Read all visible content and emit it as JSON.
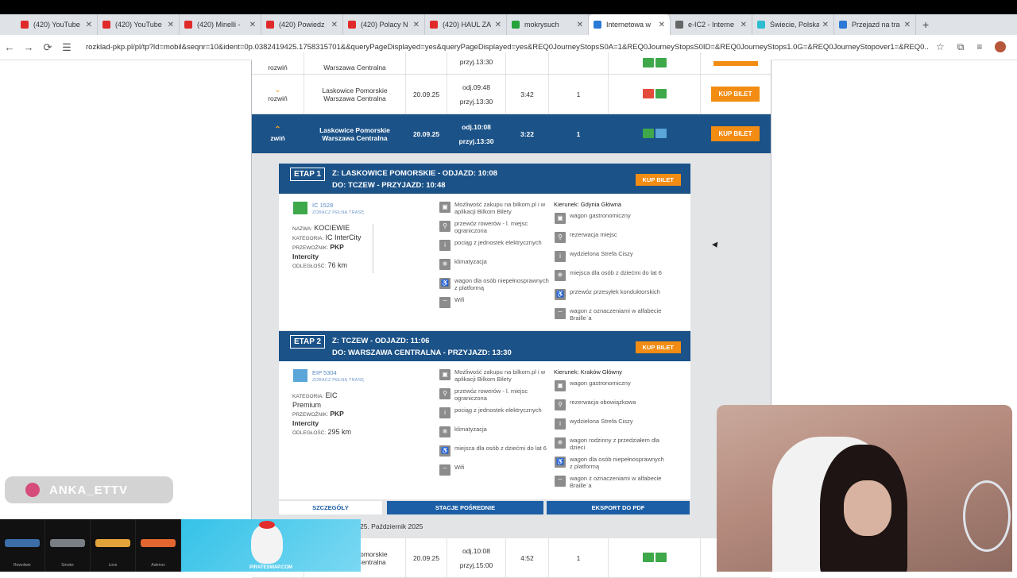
{
  "browser": {
    "tabs": [
      {
        "title": "(420) YouTube",
        "color": "#e02a2a"
      },
      {
        "title": "(420) YouTube",
        "color": "#e02a2a"
      },
      {
        "title": "(420) Minelli -",
        "color": "#e02a2a"
      },
      {
        "title": "(420) Powiedz",
        "color": "#e02a2a"
      },
      {
        "title": "(420) Polacy N",
        "color": "#e02a2a"
      },
      {
        "title": "(420) HAUL ZA",
        "color": "#e02a2a"
      },
      {
        "title": "mokrysuch",
        "color": "#25a33a"
      },
      {
        "title": "Internetowa w",
        "color": "#2b79d6"
      },
      {
        "title": "e-IC2 - Interne",
        "color": "#666666"
      },
      {
        "title": "Świecie, Polska",
        "color": "#2dbcd0"
      },
      {
        "title": "Przejazd na tra",
        "color": "#2b79d6"
      }
    ],
    "url": "rozklad-pkp.pl/pl/tp?ld=mobil&seqnr=10&ident=0p.0382419425.1758315701&&queryPageDisplayed=yes&queryPageDisplayed=yes&REQ0JourneyStopsS0A=1&REQ0JourneyStopsS0ID=&REQ0JourneyStops1.0G=&REQ0JourneyStopover1=&REQ0..."
  },
  "rows": {
    "top": {
      "toggle": "rozwiń",
      "from": "Laskowice Pomorskie",
      "to": "Warszawa Centralna",
      "arr": "przyj.13:30"
    },
    "r1": {
      "toggle": "rozwiń",
      "from": "Laskowice Pomorskie",
      "to": "Warszawa Centralna",
      "date": "20.09.25",
      "dep": "odj.09:48",
      "arr": "przyj.13:30",
      "dur": "3:42",
      "changes": "1",
      "buy": "KUP BILET"
    },
    "r2": {
      "toggle": "zwiń",
      "from": "Laskowice Pomorskie",
      "to": "Warszawa Centralna",
      "date": "20.09.25",
      "dep": "odj.10:08",
      "arr": "przyj.13:30",
      "dur": "3:22",
      "changes": "1",
      "buy": "KUP BILET"
    },
    "r3": {
      "from": "Laskowice Pomorskie",
      "to": "Warszawa Centralna",
      "date": "20.09.25",
      "dep": "odj.10:08",
      "arr": "przyj.15:00",
      "dur": "4:52",
      "changes": "1"
    }
  },
  "etap1": {
    "badge": "ETAP 1",
    "line1": "Z: LASKOWICE POMORSKIE - ODJAZD: 10:08",
    "line2": "DO: TCZEW - PRZYJAZD: 10:48",
    "buy": "KUP BILET",
    "train_no": "IC 1528",
    "route_link": "ZOBACZ PEŁNĄ TRASĘ",
    "nazwa_k": "NAZWA:",
    "nazwa_v": "KOCIEWIE",
    "kat_k": "KATEGORIA:",
    "kat_v": "IC InterCity",
    "prz_k": "PRZEWOŹNIK:",
    "prz_v": "PKP Intercity",
    "odl_k": "ODLEGŁOŚĆ:",
    "odl_v": "76 km",
    "kierunek": "Kierunek: Gdynia Główna",
    "features_left": [
      "Możliwość zakupu na bilkom.pl i w aplikacji Bilkom Bilety",
      "przewóz rowerów - l. miejsc ograniczona",
      "pociąg z jednostek elektrycznych",
      "klimatyzacja",
      "wagon dla osób niepełnosprawnych z platformą",
      "Wifi"
    ],
    "features_right": [
      "wagon gastronomiczny",
      "rezerwacja miejsc",
      "wydzielona Strefa Ciszy",
      "miejsca dla osób z dziećmi do lat 6",
      "przewóz przesyłek konduktorskich",
      "wagon z oznaczeniami w alfabecie Braille`a"
    ]
  },
  "etap2": {
    "badge": "ETAP 2",
    "line1": "Z: TCZEW - ODJAZD: 11:06",
    "line2": "DO: WARSZAWA CENTRALNA - PRZYJAZD: 13:30",
    "buy": "KUP BILET",
    "train_no": "EIP 5304",
    "route_link": "ZOBACZ PEŁNĄ TRASĘ",
    "kat_k": "KATEGORIA:",
    "kat_v": "EIC Premium",
    "prz_k": "PRZEWOŹNIK:",
    "prz_v": "PKP Intercity",
    "odl_k": "ODLEGŁOŚĆ:",
    "odl_v": "295 km",
    "kierunek": "Kierunek: Kraków Główny",
    "features_left": [
      "Możliwość zakupu na bilkom.pl i w aplikacji Bilkom Bilety",
      "przewóz rowerów - l. miejsc ograniczona",
      "pociąg z jednostek elektrycznych",
      "klimatyzacja",
      "miejsca dla osób z dziećmi do lat 6",
      "Wifi"
    ],
    "features_right": [
      "wagon gastronomiczny",
      "rezerwacja obowiązkowa",
      "wydzielona Strefa Ciszy",
      "wagon rodzinny z przedziałem dla dzieci",
      "wagon dla osób niepełnosprawnych z platformą",
      "wagon z oznaczeniami w alfabecie Braille`a"
    ]
  },
  "footer": {
    "details": "SZCZEGÓŁY",
    "stations": "STACJE POŚREDNIE",
    "pdf": "EKSPORT DO PDF",
    "date": "25. Październik 2025"
  },
  "overlay": {
    "twitch": "ANKA_ETTV",
    "ad": "PIRATESWAP.COM",
    "guns": [
      "Rewolwer",
      "Smoke",
      "Love",
      "Asiimov"
    ]
  }
}
